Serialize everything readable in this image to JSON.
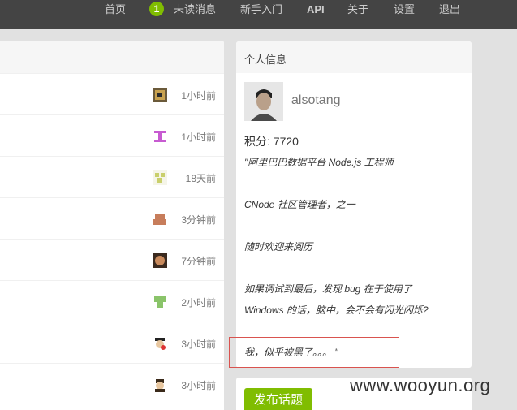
{
  "nav": {
    "items": [
      "首页",
      "未读消息",
      "新手入门",
      "API",
      "关于",
      "设置",
      "退出"
    ],
    "unread_count": "1"
  },
  "topics": [
    {
      "time": "1小时前",
      "avatar": "avatar-1"
    },
    {
      "time": "1小时前",
      "avatar": "avatar-2"
    },
    {
      "time": "18天前",
      "avatar": "avatar-3"
    },
    {
      "time": "3分钟前",
      "avatar": "avatar-4"
    },
    {
      "time": "7分钟前",
      "avatar": "avatar-5"
    },
    {
      "time": "2小时前",
      "avatar": "avatar-6"
    },
    {
      "time": "3小时前",
      "avatar": "avatar-7"
    },
    {
      "time": "3小时前",
      "avatar": "avatar-8"
    }
  ],
  "profile": {
    "title": "个人信息",
    "username": "alsotang",
    "score": "积分: 7720",
    "signature": [
      "\"阿里巴巴数据平台 Node.js 工程师",
      "CNode 社区管理者，之一",
      "随时欢迎来阅历",
      "如果调试到最后，发现 bug 在于使用了",
      "Windows 的话，脑中，会不会有闪光闪烁?",
      "我，似乎被黑了。。。 \""
    ]
  },
  "publish": {
    "label": "发布话题"
  },
  "watermark": "www.wooyun.org",
  "colors": {
    "accent": "#80bd01",
    "topbar": "#444444",
    "highlight": "#d9534f"
  }
}
